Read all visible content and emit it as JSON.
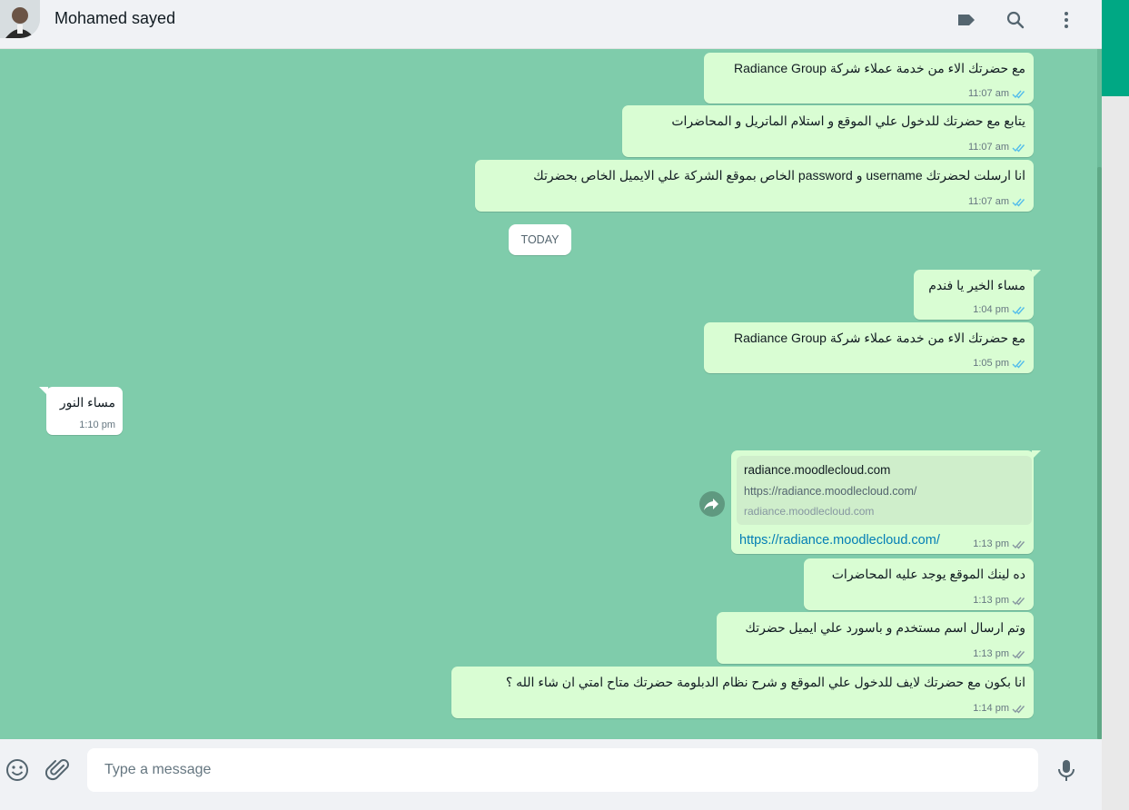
{
  "header": {
    "contact_name": "Mohamed sayed",
    "icons": [
      "label-icon",
      "search-icon",
      "menu-icon"
    ]
  },
  "date_separator": "TODAY",
  "messages": [
    {
      "dir": "out",
      "text": "مع حضرتك الاء من خدمة عملاء شركة Radiance Group",
      "time": "11:07 am",
      "status": "read"
    },
    {
      "dir": "out",
      "text": "يتابع  مع حضرتك للدخول  علي الموقع و استلام الماتريل و المحاضرات",
      "time": "11:07 am",
      "status": "read"
    },
    {
      "dir": "out",
      "text": "انا ارسلت لحضرتك username  و  password  الخاص بموقع الشركة علي الايميل الخاص بحضرتك",
      "time": "11:07 am",
      "status": "read"
    },
    {
      "dir": "out",
      "text": "مساء الخير يا فندم",
      "time": "1:04 pm",
      "status": "read"
    },
    {
      "dir": "out",
      "text": "مع حضرتك الاء من خدمة عملاء شركة Radiance Group",
      "time": "1:05 pm",
      "status": "read"
    },
    {
      "dir": "in",
      "text": "مساء النور",
      "time": "1:10 pm"
    },
    {
      "dir": "out",
      "text": "https://radiance.moodlecloud.com/",
      "time": "1:13 pm",
      "status": "delivered",
      "preview": {
        "title": "radiance.moodlecloud.com",
        "description": "https://radiance.moodlecloud.com/",
        "domain": "radiance.moodlecloud.com"
      }
    },
    {
      "dir": "out",
      "text": "ده لينك الموقع يوجد عليه المحاضرات",
      "time": "1:13 pm",
      "status": "delivered"
    },
    {
      "dir": "out",
      "text": "وتم ارسال اسم مستخدم و باسورد علي ايميل حضرتك",
      "time": "1:13 pm",
      "status": "delivered"
    },
    {
      "dir": "out",
      "text": "انا بكون مع حضرتك لايف للدخول علي الموقع و شرح نظام الدبلومة حضرتك متاح امتي ان شاء الله ؟",
      "time": "1:14 pm",
      "status": "delivered"
    }
  ],
  "composer": {
    "placeholder": "Type a message",
    "icons": [
      "emoji-icon",
      "attach-icon",
      "mic-icon"
    ]
  },
  "colors": {
    "chat_background": "#7fccab",
    "outgoing_bubble": "#d9fdd3",
    "incoming_bubble": "#ffffff",
    "read_tick": "#53bdeb",
    "delivered_tick": "#8696a0",
    "link": "#027eb5",
    "accent": "#00a884"
  }
}
